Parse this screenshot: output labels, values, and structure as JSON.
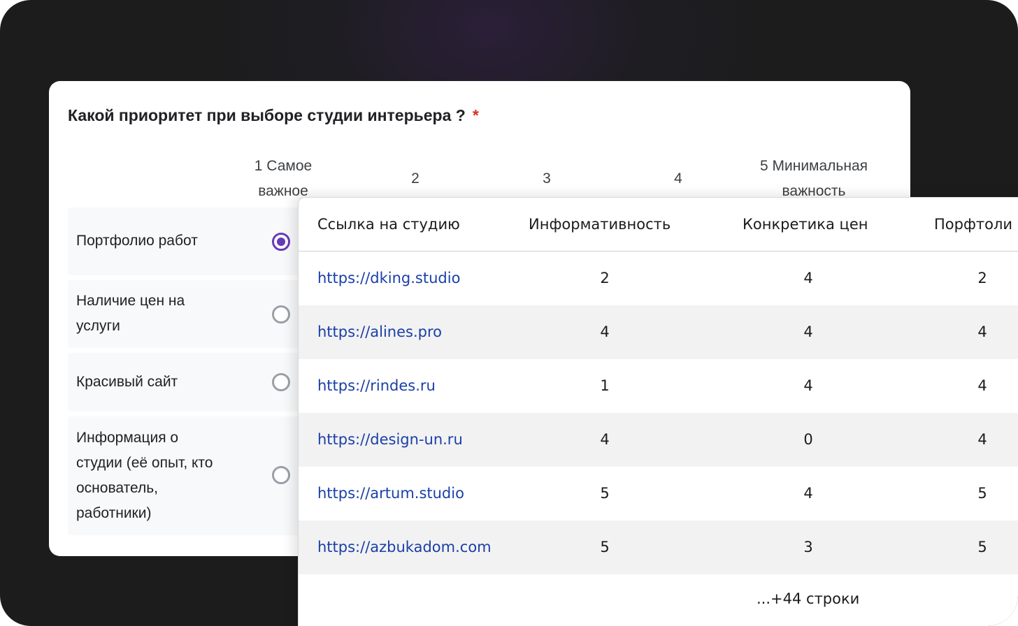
{
  "survey": {
    "question": "Какой приоритет при выборе студии интерьера  ?",
    "required_mark": "*",
    "column_headers": [
      "1 Самое важное",
      "2",
      "3",
      "4",
      "5 Минимальная важность"
    ],
    "rows": [
      {
        "label": "Портфолио работ",
        "selected": true
      },
      {
        "label": "Наличие цен на услуги",
        "selected": false
      },
      {
        "label": "Красивый сайт",
        "selected": false
      },
      {
        "label": "Информация о студии (её опыт, кто основатель, работники)",
        "selected": false
      }
    ]
  },
  "results_table": {
    "headers": [
      "Ссылка на студию",
      "Информативность",
      "Конкретика цен",
      "Порфтоли"
    ],
    "rows": [
      {
        "url": "https://dking.studio",
        "informativeness": "2",
        "prices": "4",
        "portfolio": "2"
      },
      {
        "url": "https://alines.pro",
        "informativeness": "4",
        "prices": "4",
        "portfolio": "4"
      },
      {
        "url": "https://rindes.ru",
        "informativeness": "1",
        "prices": "4",
        "portfolio": "4"
      },
      {
        "url": "https://design-un.ru",
        "informativeness": "4",
        "prices": "0",
        "portfolio": "4"
      },
      {
        "url": "https://artum.studio",
        "informativeness": "5",
        "prices": "4",
        "portfolio": "5"
      },
      {
        "url": "https://azbukadom.com",
        "informativeness": "5",
        "prices": "3",
        "portfolio": "5"
      }
    ],
    "more_rows_label": "...+44 строки"
  },
  "colors": {
    "background": "#1c1c1c",
    "accent_radio": "#673ab7",
    "required": "#d93025",
    "link": "#1a3fa8",
    "row_shade": "#f2f2f2"
  }
}
